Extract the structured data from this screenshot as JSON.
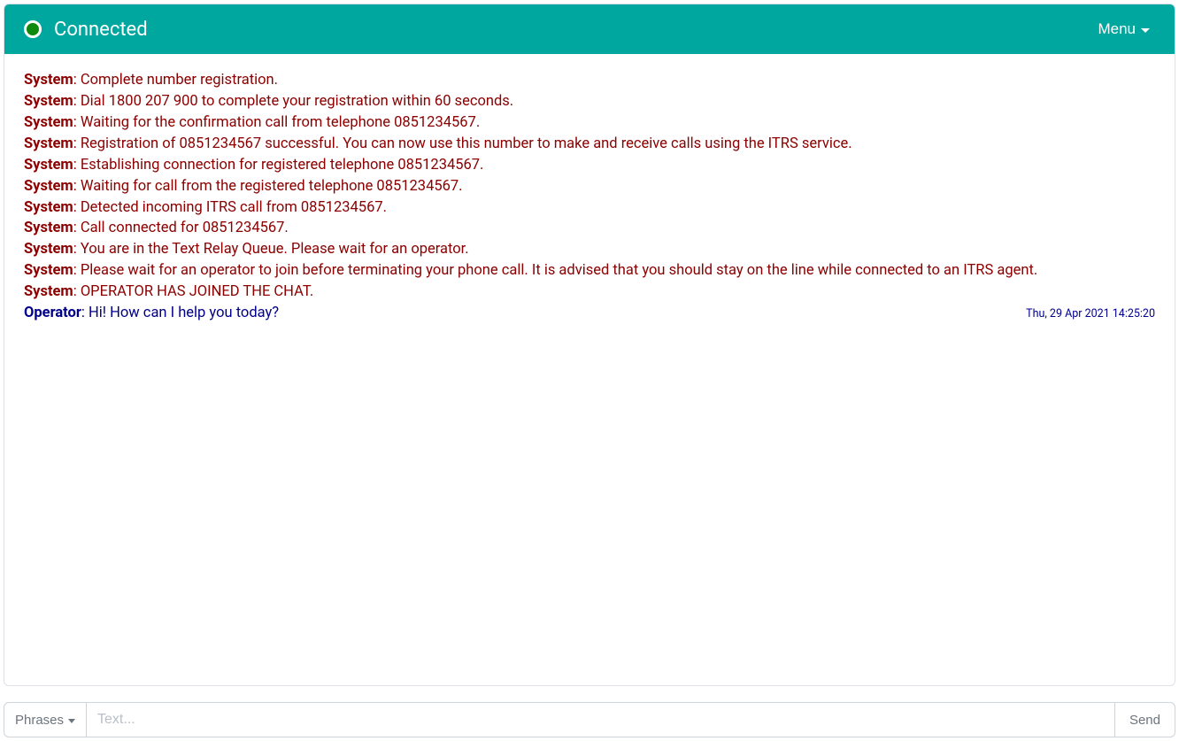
{
  "colors": {
    "header_bg": "#00a79e",
    "system_text": "#8b0000",
    "operator_text": "#00008b",
    "status_dot": "#0f8a0f"
  },
  "header": {
    "status_label": "Connected",
    "menu_label": "Menu"
  },
  "messages": [
    {
      "sender": "System",
      "kind": "system",
      "text": "Complete number registration."
    },
    {
      "sender": "System",
      "kind": "system",
      "text": "Dial 1800 207 900 to complete your registration within 60 seconds."
    },
    {
      "sender": "System",
      "kind": "system",
      "text": "Waiting for the confirmation call from telephone 0851234567."
    },
    {
      "sender": "System",
      "kind": "system",
      "text": "Registration of 0851234567 successful. You can now use this number to make and receive calls using the ITRS service."
    },
    {
      "sender": "System",
      "kind": "system",
      "text": "Establishing connection for registered telephone 0851234567."
    },
    {
      "sender": "System",
      "kind": "system",
      "text": "Waiting for call from the registered telephone 0851234567."
    },
    {
      "sender": "System",
      "kind": "system",
      "text": "Detected incoming ITRS call from 0851234567."
    },
    {
      "sender": "System",
      "kind": "system",
      "text": "Call connected for 0851234567."
    },
    {
      "sender": "System",
      "kind": "system",
      "text": "You are in the Text Relay Queue. Please wait for an operator."
    },
    {
      "sender": "System",
      "kind": "system",
      "text": "Please wait for an operator to join before terminating your phone call. It is advised that you should stay on the line while connected to an ITRS agent."
    },
    {
      "sender": "System",
      "kind": "system",
      "text": "OPERATOR HAS JOINED THE CHAT."
    },
    {
      "sender": "Operator",
      "kind": "operator",
      "text": "Hi! How can I help you today?",
      "timestamp": "Thu, 29 Apr 2021 14:25:20"
    }
  ],
  "composer": {
    "phrases_label": "Phrases",
    "placeholder": "Text...",
    "send_label": "Send",
    "value": ""
  }
}
